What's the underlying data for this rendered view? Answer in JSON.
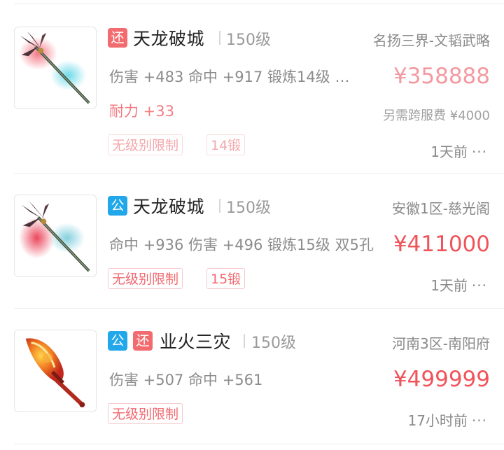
{
  "listings": [
    {
      "tags": [
        "还"
      ],
      "name": "天龙破城",
      "level": "150级",
      "server": "名扬三界-文韬武略",
      "attrs": "伤害 +483 命中 +917 锻炼14级 …",
      "price": "¥358888",
      "extra": "耐力 +33",
      "fee": "另需跨服费 ¥4000",
      "badges": [
        "无级别限制",
        "14锻"
      ],
      "time": "1天前",
      "more": "···"
    },
    {
      "tags": [
        "公"
      ],
      "name": "天龙破城",
      "level": "150级",
      "server": "安徽1区-慈光阁",
      "attrs": "命中 +936 伤害 +496 锻炼15级 双5孔",
      "price": "¥411000",
      "badges": [
        "无级别限制",
        "15锻"
      ],
      "time": "1天前",
      "more": "···"
    },
    {
      "tags": [
        "公",
        "还"
      ],
      "name": "业火三灾",
      "level": "150级",
      "server": "河南3区-南阳府",
      "attrs": "伤害 +507 命中 +561",
      "price": "¥499999",
      "badges": [
        "无级别限制"
      ],
      "time": "17小时前",
      "more": "···"
    }
  ],
  "colors": {
    "gong_tag": "#22a8ea",
    "huan_tag": "#f26c6f",
    "price": "#f0545b",
    "badge_text": "#f16a71"
  },
  "icons": {
    "item1": "spear-weapon-icon",
    "item2": "spear-weapon-icon",
    "item3": "flame-sword-weapon-icon"
  }
}
